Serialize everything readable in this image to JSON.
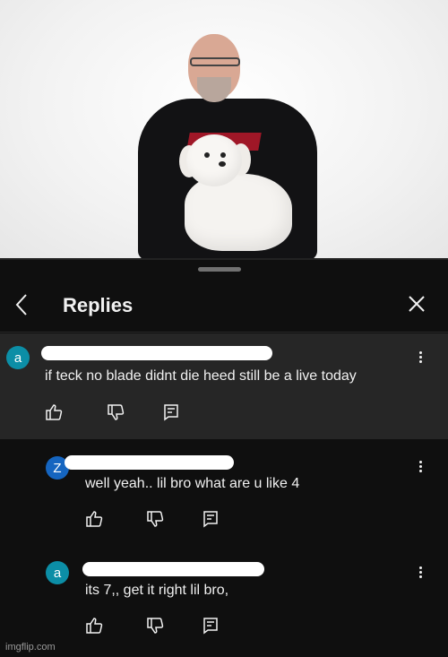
{
  "header": {
    "title": "Replies"
  },
  "comments": [
    {
      "avatar_letter": "a",
      "text": "if teck no blade didnt die heed still be a live today"
    },
    {
      "avatar_letter": "Z",
      "text": "well yeah.. lil bro what are u like 4"
    },
    {
      "avatar_letter": "a",
      "text": "its 7,, get it right lil bro,"
    }
  ],
  "icons": {
    "back": "chevron-left-icon",
    "close": "close-icon",
    "more": "more-vert-icon",
    "like": "thumbs-up-icon",
    "dislike": "thumbs-down-icon",
    "reply": "reply-icon"
  },
  "colors": {
    "background": "#0f0f0f",
    "highlight": "#262626",
    "avatar_a": "#0c8ea6",
    "avatar_z": "#1565c0"
  },
  "watermark": "imgflip.com"
}
